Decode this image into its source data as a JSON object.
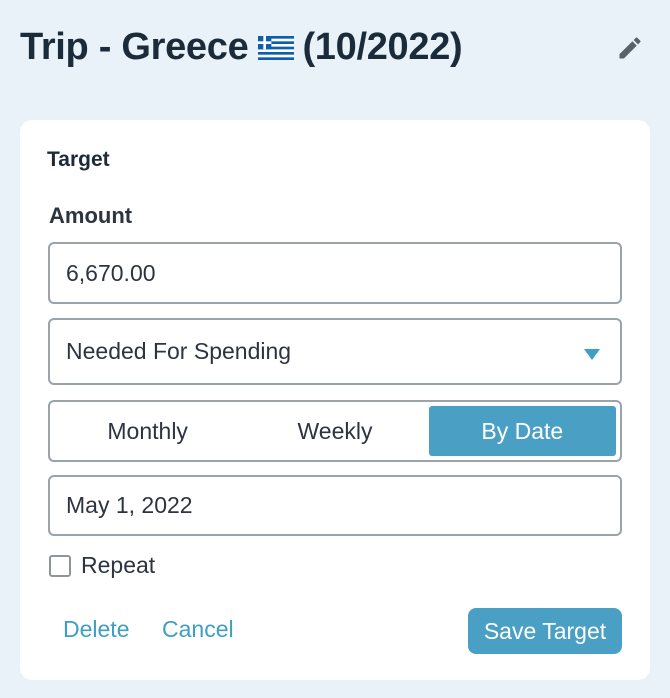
{
  "header": {
    "title_prefix": "Trip - Greece",
    "title_suffix": "(10/2022)",
    "flag_icon": "greece-flag-icon",
    "edit_icon": "pencil-icon"
  },
  "target": {
    "section_title": "Target",
    "amount_label": "Amount",
    "amount_value": "6,670.00",
    "type_value": "Needed For Spending",
    "frequency_tabs": [
      {
        "label": "Monthly",
        "active": false
      },
      {
        "label": "Weekly",
        "active": false
      },
      {
        "label": "By Date",
        "active": true
      }
    ],
    "date_value": "May 1, 2022",
    "repeat_label": "Repeat",
    "repeat_checked": false
  },
  "actions": {
    "delete_label": "Delete",
    "cancel_label": "Cancel",
    "save_label": "Save Target"
  },
  "colors": {
    "background": "#e8f2f8",
    "accent": "#4a9fc5",
    "link": "#3f9ec4",
    "text": "#1c2b3a"
  }
}
